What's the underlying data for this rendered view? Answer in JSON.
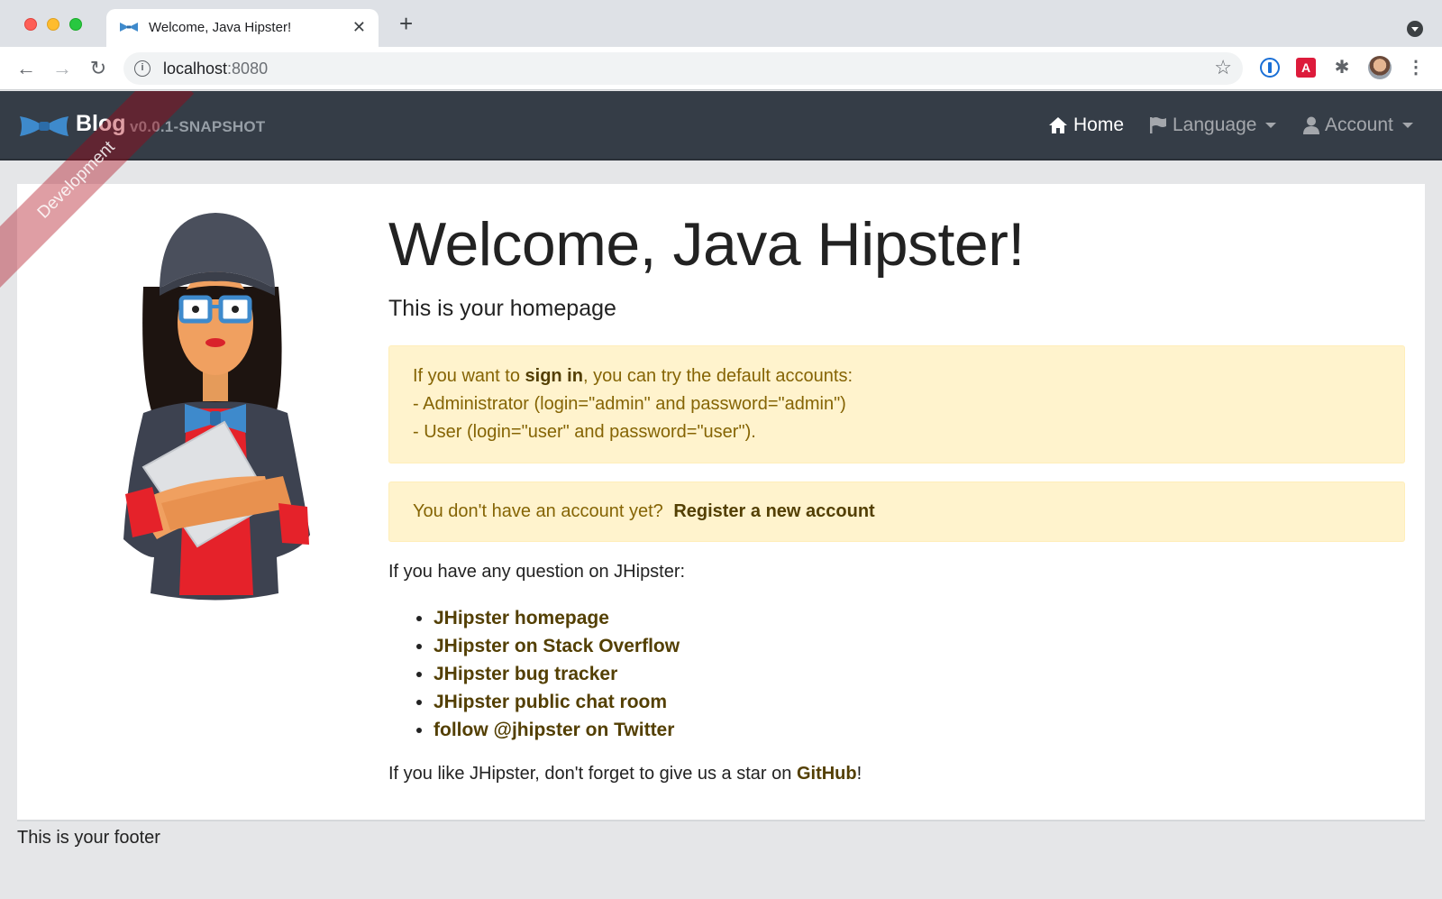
{
  "browser": {
    "tab_title": "Welcome, Java Hipster!",
    "url_host": "localhost",
    "url_port": ":8080"
  },
  "navbar": {
    "brand": "Blog",
    "version": "v0.0.1-SNAPSHOT",
    "home": "Home",
    "language": "Language",
    "account": "Account"
  },
  "ribbon": "Development",
  "home": {
    "title": "Welcome, Java Hipster!",
    "subtitle": "This is your homepage",
    "signin_prefix": "If you want to ",
    "signin_bold": "sign in",
    "signin_suffix": ", you can try the default accounts:",
    "admin_line": "- Administrator (login=\"admin\" and password=\"admin\")",
    "user_line": "- User (login=\"user\" and password=\"user\").",
    "register_prompt": "You don't have an account yet?",
    "register_link": "Register a new account",
    "question": "If you have any question on JHipster:",
    "links": [
      "JHipster homepage",
      "JHipster on Stack Overflow",
      "JHipster bug tracker",
      "JHipster public chat room",
      "follow @jhipster on Twitter"
    ],
    "star_prefix": "If you like JHipster, don't forget to give us a star on ",
    "star_link": "GitHub",
    "star_suffix": "!"
  },
  "footer": "This is your footer",
  "colors": {
    "navbar_bg": "#353d47",
    "alert_bg": "#fff3cd",
    "alert_text": "#856404",
    "link_text": "#533f03"
  }
}
